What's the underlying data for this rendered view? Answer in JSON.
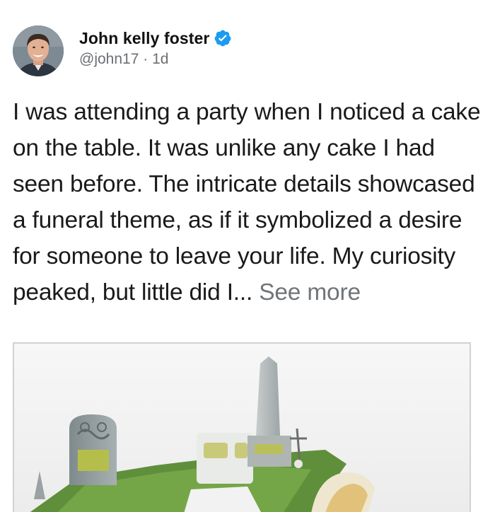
{
  "tweet": {
    "author": {
      "display_name": "John kelly foster",
      "verified": true,
      "handle": "@john17",
      "separator": " · ",
      "time": "1d"
    },
    "text": "I was attending a party when I noticed a cake on the table. It was unlike any cake I had seen before. The intricate details showcased a funeral theme, as if it symbolized a desire for someone to leave your life. My curiosity peaked, but little did I... ",
    "see_more": "See more",
    "media": {
      "description_icon": "cake-photo"
    }
  },
  "colors": {
    "verified_blue": "#1d9bf0",
    "handle_gray": "#6b6f73",
    "see_more_gray": "#707478",
    "text": "#1a1a1a"
  }
}
